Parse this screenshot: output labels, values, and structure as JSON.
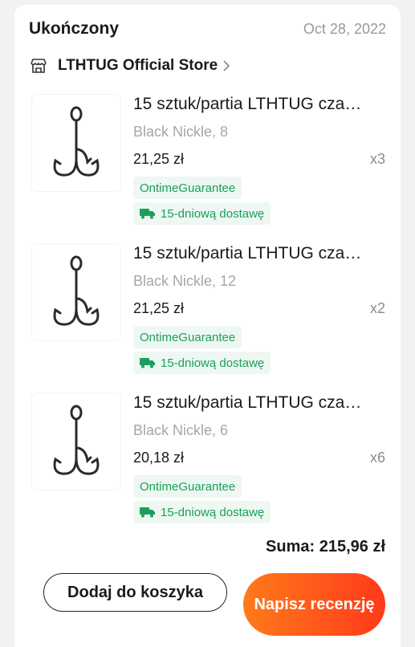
{
  "order": {
    "status": "Ukończony",
    "date": "Oct 28, 2022",
    "store_name": "LTHTUG Official Store",
    "store_icon": "store-icon",
    "items": [
      {
        "title": "15 sztuk/partia LTHTUG cza…",
        "variant": "Black Nickle, 8",
        "price": "21,25 zł",
        "qty": "x3",
        "badge_guarantee": "OntimeGuarantee",
        "badge_shipping": "15-dniową dostawę"
      },
      {
        "title": "15 sztuk/partia LTHTUG cza…",
        "variant": "Black Nickle, 12",
        "price": "21,25 zł",
        "qty": "x2",
        "badge_guarantee": "OntimeGuarantee",
        "badge_shipping": "15-dniową dostawę"
      },
      {
        "title": "15 sztuk/partia LTHTUG cza…",
        "variant": "Black Nickle, 6",
        "price": "20,18 zł",
        "qty": "x6",
        "badge_guarantee": "OntimeGuarantee",
        "badge_shipping": "15-dniową dostawę"
      }
    ],
    "total": "Suma: 215,96 zł"
  },
  "actions": {
    "add_to_cart": "Dodaj do koszyka",
    "write_review": "Napisz recenzję"
  },
  "colors": {
    "accent_orange": "#ff5a1a",
    "guarantee_green": "#1aa05a"
  }
}
